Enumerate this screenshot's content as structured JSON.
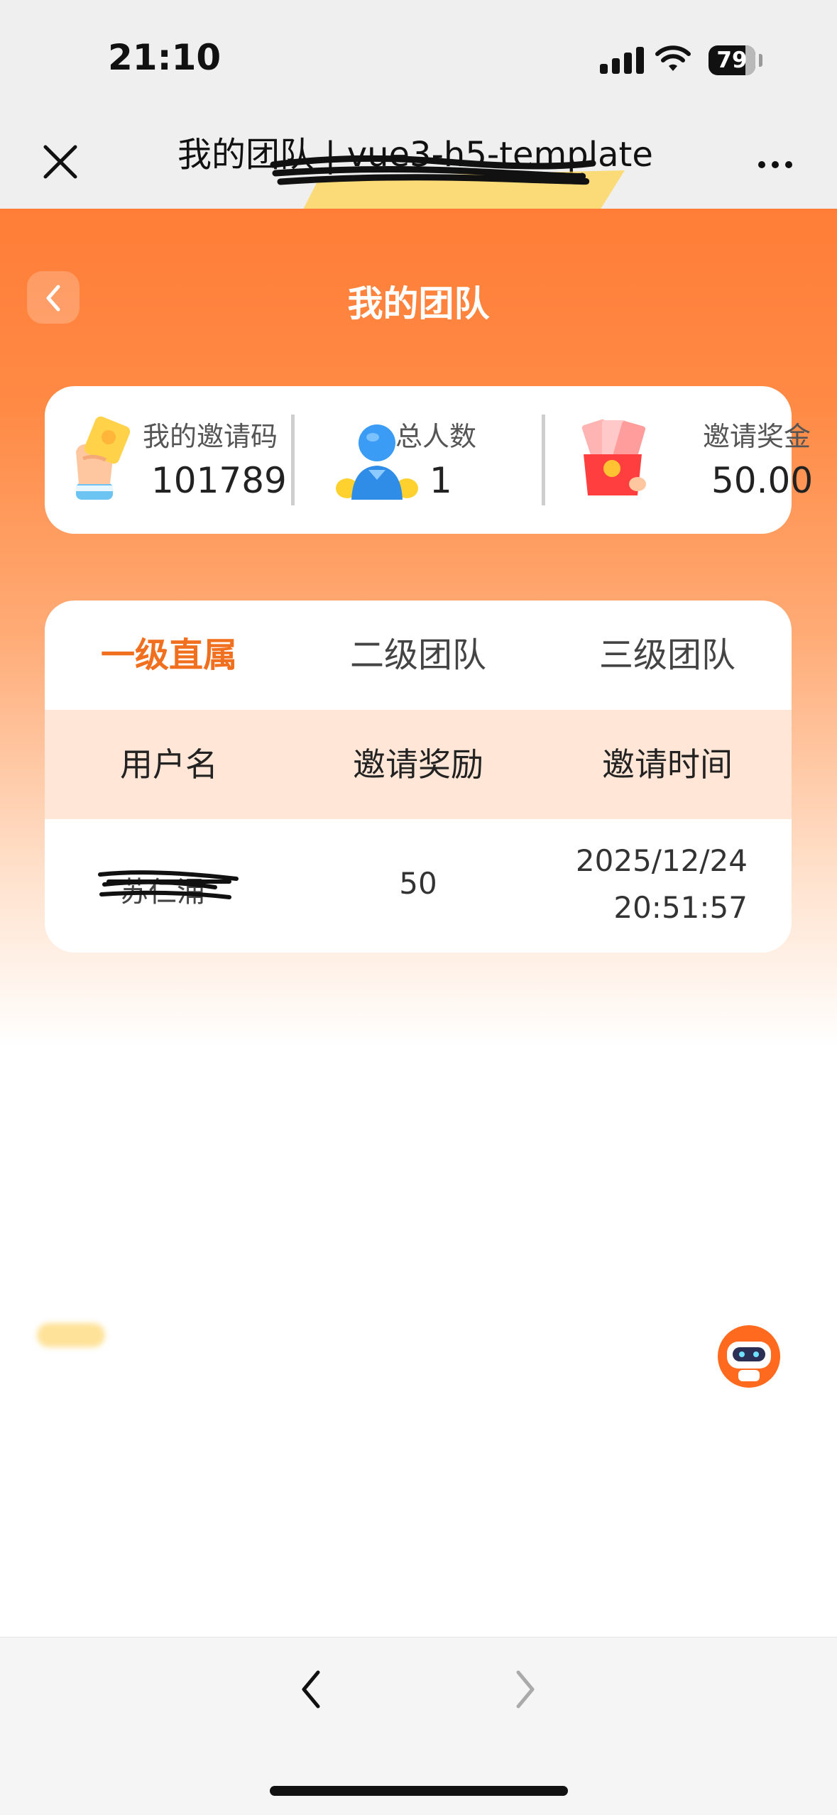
{
  "status_bar": {
    "time": "21:10",
    "battery": "79"
  },
  "browser": {
    "title": "我的团队 | vue3-h5-template"
  },
  "page": {
    "title": "我的团队"
  },
  "stats": [
    {
      "label": "我的邀请码",
      "value": "101789"
    },
    {
      "label": "总人数",
      "value": "1"
    },
    {
      "label": "邀请奖金",
      "value": "50.00"
    }
  ],
  "tabs": [
    {
      "label": "一级直属",
      "active": true
    },
    {
      "label": "二级团队",
      "active": false
    },
    {
      "label": "三级团队",
      "active": false
    }
  ],
  "table": {
    "headers": [
      "用户名",
      "邀请奖励",
      "邀请时间"
    ],
    "rows": [
      {
        "username": "苏仁涌",
        "reward": "50",
        "date": "2025/12/24",
        "time": "20:51:57"
      }
    ]
  },
  "colors": {
    "accent": "#f07020",
    "hero_top": "#ff7d37",
    "table_header_bg": "#ffe6d7"
  }
}
